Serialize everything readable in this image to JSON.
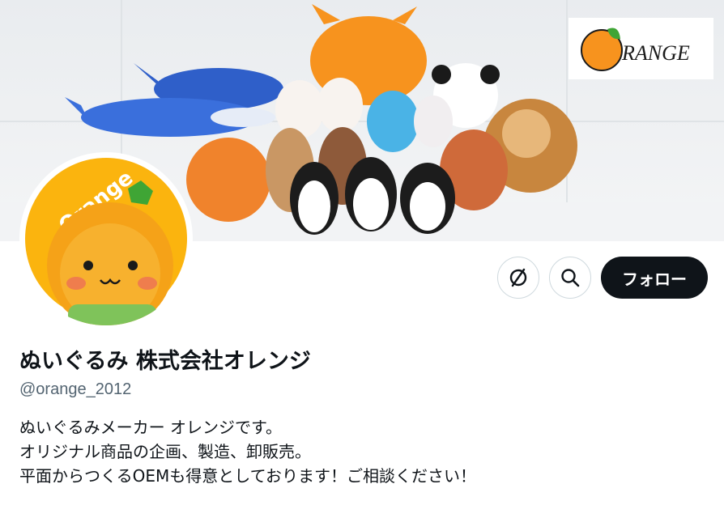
{
  "banner": {
    "logo_text": "RANGE"
  },
  "avatar": {
    "text": "Orange"
  },
  "actions": {
    "more_icon": "no-entry-icon",
    "search_icon": "search-icon",
    "follow_label": "フォロー"
  },
  "profile": {
    "name": "ぬいぐるみ 株式会社オレンジ",
    "handle": "@orange_2012",
    "bio": [
      "ぬいぐるみメーカー オレンジです。",
      "オリジナル商品の企画、製造、卸販売。",
      "平面からつくるOEMも得意としております！ご相談ください！"
    ]
  },
  "colors": {
    "accent": "#f7931e",
    "text_primary": "#0f1419",
    "text_secondary": "#536471",
    "follow_bg": "#0f1419"
  }
}
